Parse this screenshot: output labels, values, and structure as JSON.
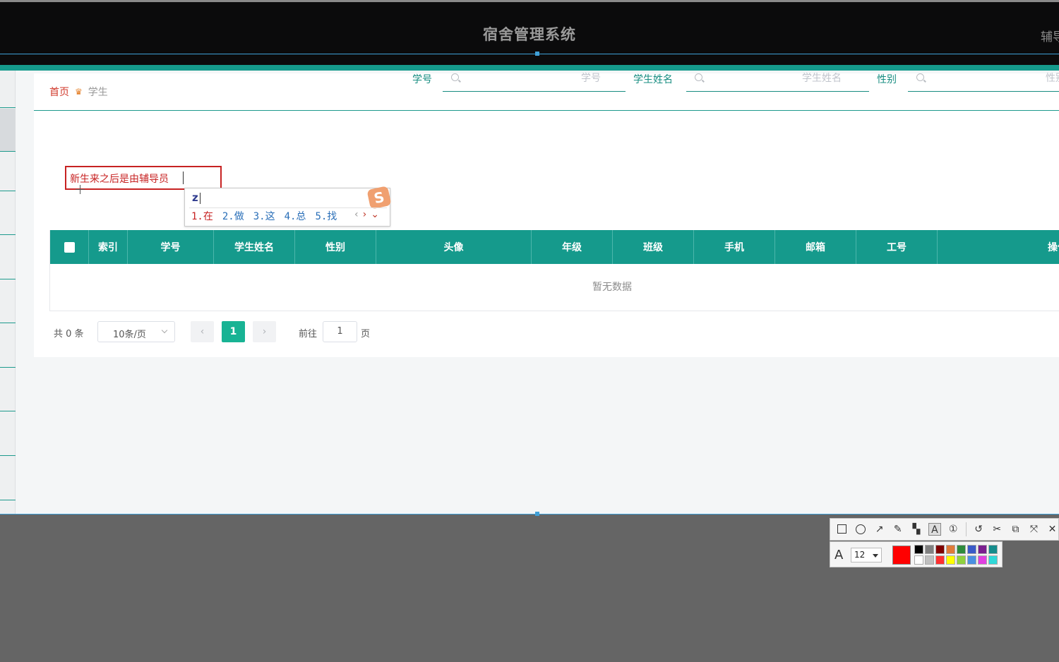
{
  "header": {
    "title": "宿舍管理系统",
    "user_label": "辅导"
  },
  "breadcrumb": {
    "home": "首页",
    "current": "学生"
  },
  "search": [
    {
      "label": "学号",
      "placeholder": "学号"
    },
    {
      "label": "学生姓名",
      "placeholder": "学生姓名"
    },
    {
      "label": "性别",
      "placeholder": "性别"
    }
  ],
  "annotation": {
    "text": "新生来之后是由辅导员"
  },
  "ime": {
    "input": "z",
    "logo": "S",
    "candidates": [
      "1.在",
      "2.做",
      "3.这",
      "4.总",
      "5.找"
    ]
  },
  "table": {
    "columns": [
      "索引",
      "学号",
      "学生姓名",
      "性别",
      "头像",
      "年级",
      "班级",
      "手机",
      "邮箱",
      "工号",
      "操作"
    ],
    "empty_text": "暂无数据"
  },
  "pagination": {
    "total": "共 0 条",
    "page_size": "10条/页",
    "current_page": "1",
    "goto_label": "前往",
    "goto_value": "1",
    "page_unit": "页"
  },
  "annotation_toolbar": {
    "font_size": "12",
    "current_color": "#ff0000",
    "palette": [
      "#000000",
      "#808080",
      "#800000",
      "#e07b39",
      "#2e8b3c",
      "#3a5ac8",
      "#7a1f8f",
      "#168c8c",
      "#ffffff",
      "#c0c0c0",
      "#ff3030",
      "#ffff00",
      "#8fd13f",
      "#4a90e2",
      "#e040e0",
      "#30d8d8"
    ]
  },
  "colors": {
    "accent": "#159a8c",
    "active_page": "#18b394",
    "annotation_red": "#c72222"
  }
}
